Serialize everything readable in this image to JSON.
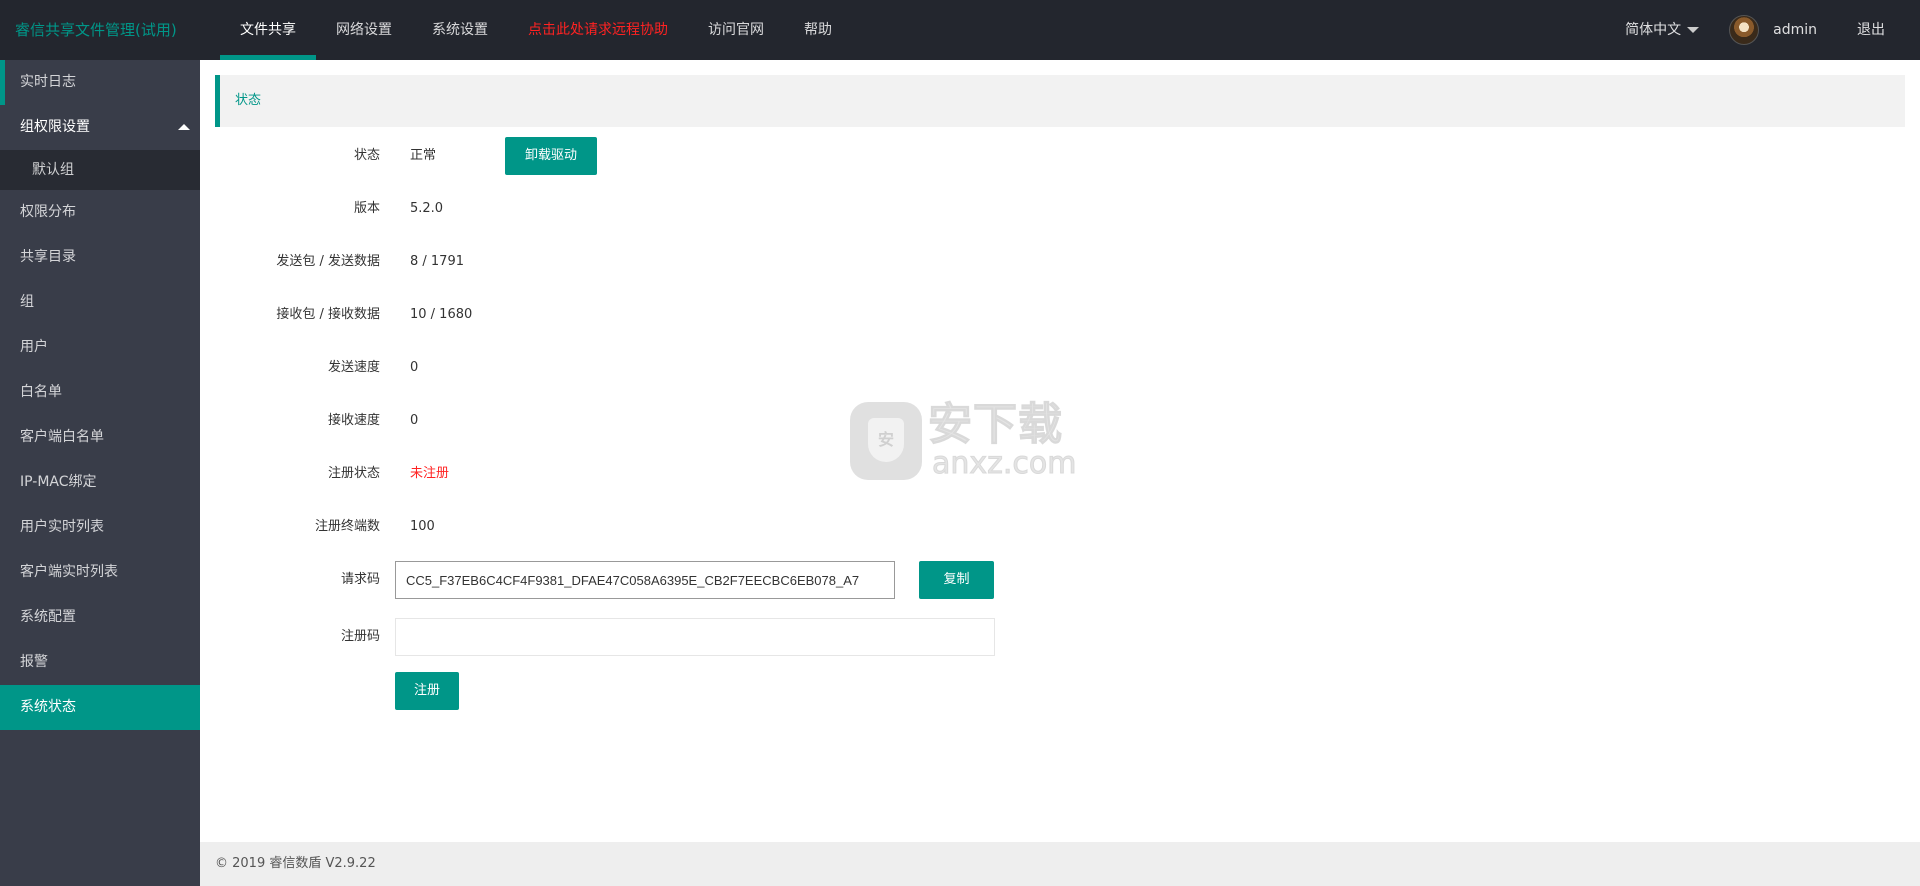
{
  "header": {
    "logo": "睿信共享文件管理(试用)",
    "nav": [
      {
        "label": "文件共享"
      },
      {
        "label": "网络设置"
      },
      {
        "label": "系统设置"
      },
      {
        "label": "点击此处请求远程协助"
      },
      {
        "label": "访问官网"
      },
      {
        "label": "帮助"
      }
    ],
    "language": "简体中文",
    "username": "admin",
    "logout": "退出"
  },
  "sidebar": {
    "items": [
      {
        "label": "实时日志"
      },
      {
        "label": "组权限设置"
      },
      {
        "label": "默认组"
      },
      {
        "label": "权限分布"
      },
      {
        "label": "共享目录"
      },
      {
        "label": "组"
      },
      {
        "label": "用户"
      },
      {
        "label": "白名单"
      },
      {
        "label": "客户端白名单"
      },
      {
        "label": "IP-MAC绑定"
      },
      {
        "label": "用户实时列表"
      },
      {
        "label": "客户端实时列表"
      },
      {
        "label": "系统配置"
      },
      {
        "label": "报警"
      },
      {
        "label": "系统状态"
      }
    ]
  },
  "main": {
    "title": "状态",
    "rows": [
      {
        "label": "状态",
        "value": "正常"
      },
      {
        "label": "版本",
        "value": "5.2.0"
      },
      {
        "label": "发送包 / 发送数据",
        "value": "8 / 1791"
      },
      {
        "label": "接收包 / 接收数据",
        "value": "10 / 1680"
      },
      {
        "label": "发送速度",
        "value": "0"
      },
      {
        "label": "接收速度",
        "value": "0"
      },
      {
        "label": "注册状态",
        "value": "未注册"
      },
      {
        "label": "注册终端数",
        "value": "100"
      }
    ],
    "uninstall_button": "卸载驱动",
    "request_code_label": "请求码",
    "request_code_value": "CC5_F37EB6C4CF4F9381_DFAE47C058A6395E_CB2F7EECBC6EB078_A7",
    "copy_button": "复制",
    "reg_code_label": "注册码",
    "reg_code_value": "",
    "register_button": "注册"
  },
  "watermark": {
    "cn": "安下载",
    "en": "anxz.com",
    "shield_char": "安"
  },
  "footer": {
    "text": "© 2019 睿信数盾 V2.9.22"
  },
  "colors": {
    "accent": "#009688",
    "header_bg": "#23262e",
    "sidebar_bg": "#393d49",
    "alert": "#ff2222"
  }
}
